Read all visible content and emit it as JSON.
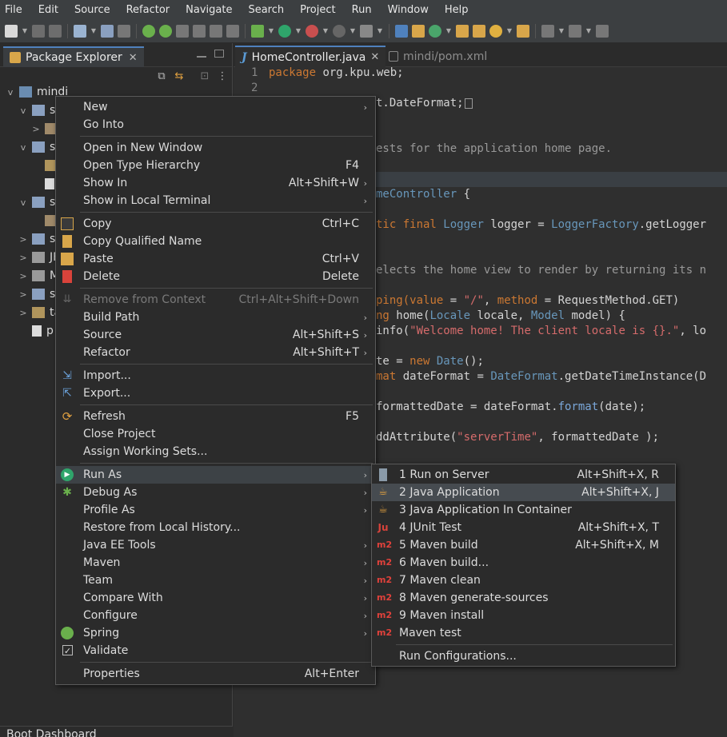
{
  "menubar": [
    "File",
    "Edit",
    "Source",
    "Refactor",
    "Navigate",
    "Search",
    "Project",
    "Run",
    "Window",
    "Help"
  ],
  "package_explorer": {
    "title": "Package Explorer",
    "tree": [
      {
        "label": "mindi",
        "arrow": "v"
      },
      {
        "label": "sr",
        "arrow": "v"
      },
      {
        "label": "",
        "arrow": ">"
      },
      {
        "label": "sr",
        "arrow": "v"
      },
      {
        "label": "",
        "arrow": ""
      },
      {
        "label": "",
        "arrow": ""
      },
      {
        "label": "sr",
        "arrow": "v"
      },
      {
        "label": "",
        "arrow": ""
      },
      {
        "label": "sr",
        "arrow": ">"
      },
      {
        "label": "JF",
        "arrow": ">"
      },
      {
        "label": "M",
        "arrow": ">"
      },
      {
        "label": "sr",
        "arrow": ">"
      },
      {
        "label": "ta",
        "arrow": ">"
      },
      {
        "label": "p",
        "arrow": ""
      }
    ]
  },
  "boot_dashboard": {
    "title": "Boot Dashboard"
  },
  "editor": {
    "tabs": [
      {
        "label": "HomeController.java",
        "active": true
      },
      {
        "label": "mindi/pom.xml",
        "active": false
      }
    ],
    "line_numbers": [
      "1",
      "2"
    ],
    "lines": {
      "l1_kw": "package",
      "l1_rest": " org.kpu.web;",
      "l3": "t.DateFormat;",
      "l6": "ests for the application home page.",
      "l9_a": "meController",
      "l9_b": " {",
      "l11_a": "tic final",
      "l11_b": "Logger",
      "l11_c": " logger = ",
      "l11_d": "LoggerFactory",
      "l11_e": ".getLogger",
      "l14": "elects the home view to render by returning its n",
      "l16_a": "ping(",
      "l16_b": "value",
      "l16_c": " = ",
      "l16_d": "\"/\"",
      "l16_e": ", ",
      "l16_f": "method",
      "l16_g": " = RequestMethod.GET)",
      "l17_a": "ng",
      "l17_b": " home(",
      "l17_c": "Locale",
      "l17_d": " locale, ",
      "l17_e": "Model",
      "l17_f": " model) {",
      "l18_a": "info(",
      "l18_b": "\"Welcome home! The client locale is {}.\"",
      "l18_c": ", lo",
      "l20_a": "te = ",
      "l20_b": "new",
      "l20_c": " Date",
      "l20_d": "();",
      "l21_a": "mat",
      "l21_b": " dateFormat = ",
      "l21_c": "DateFormat",
      "l21_d": ".getDateTimeInstance(D",
      "l23_a": "formattedDate = dateFormat.",
      "l23_b": "format",
      "l23_c": "(date);",
      "l25_a": "ddAttribute(",
      "l25_b": "\"serverTime\"",
      "l25_c": ", formattedDate );"
    }
  },
  "context_menu": {
    "items": [
      {
        "label": "New",
        "shortcut": "",
        "submenu": true
      },
      {
        "label": "Go Into",
        "shortcut": "",
        "submenu": false
      },
      {
        "label": "Open in New Window",
        "shortcut": "",
        "submenu": false
      },
      {
        "label": "Open Type Hierarchy",
        "shortcut": "F4",
        "submenu": false
      },
      {
        "label": "Show In",
        "shortcut": "Alt+Shift+W",
        "submenu": true
      },
      {
        "label": "Show in Local Terminal",
        "shortcut": "",
        "submenu": true
      },
      {
        "label": "Copy",
        "shortcut": "Ctrl+C",
        "submenu": false
      },
      {
        "label": "Copy Qualified Name",
        "shortcut": "",
        "submenu": false
      },
      {
        "label": "Paste",
        "shortcut": "Ctrl+V",
        "submenu": false
      },
      {
        "label": "Delete",
        "shortcut": "Delete",
        "submenu": false
      },
      {
        "label": "Remove from Context",
        "shortcut": "Ctrl+Alt+Shift+Down",
        "submenu": false,
        "disabled": true
      },
      {
        "label": "Build Path",
        "shortcut": "",
        "submenu": true
      },
      {
        "label": "Source",
        "shortcut": "Alt+Shift+S",
        "submenu": true
      },
      {
        "label": "Refactor",
        "shortcut": "Alt+Shift+T",
        "submenu": true
      },
      {
        "label": "Import...",
        "shortcut": "",
        "submenu": false
      },
      {
        "label": "Export...",
        "shortcut": "",
        "submenu": false
      },
      {
        "label": "Refresh",
        "shortcut": "F5",
        "submenu": false
      },
      {
        "label": "Close Project",
        "shortcut": "",
        "submenu": false
      },
      {
        "label": "Assign Working Sets...",
        "shortcut": "",
        "submenu": false
      },
      {
        "label": "Run As",
        "shortcut": "",
        "submenu": true,
        "selected": true
      },
      {
        "label": "Debug As",
        "shortcut": "",
        "submenu": true
      },
      {
        "label": "Profile As",
        "shortcut": "",
        "submenu": true
      },
      {
        "label": "Restore from Local History...",
        "shortcut": "",
        "submenu": false
      },
      {
        "label": "Java EE Tools",
        "shortcut": "",
        "submenu": true
      },
      {
        "label": "Maven",
        "shortcut": "",
        "submenu": true
      },
      {
        "label": "Team",
        "shortcut": "",
        "submenu": true
      },
      {
        "label": "Compare With",
        "shortcut": "",
        "submenu": true
      },
      {
        "label": "Configure",
        "shortcut": "",
        "submenu": true
      },
      {
        "label": "Spring",
        "shortcut": "",
        "submenu": true
      },
      {
        "label": "Validate",
        "shortcut": "",
        "submenu": false
      },
      {
        "label": "Properties",
        "shortcut": "Alt+Enter",
        "submenu": false
      }
    ]
  },
  "run_as_submenu": {
    "items": [
      {
        "label": "1 Run on Server",
        "shortcut": "Alt+Shift+X, R"
      },
      {
        "label": "2 Java Application",
        "shortcut": "Alt+Shift+X, J",
        "selected": true
      },
      {
        "label": "3 Java Application In Container",
        "shortcut": ""
      },
      {
        "label": "4 JUnit Test",
        "shortcut": "Alt+Shift+X, T"
      },
      {
        "label": "5 Maven build",
        "shortcut": "Alt+Shift+X, M"
      },
      {
        "label": "6 Maven build...",
        "shortcut": ""
      },
      {
        "label": "7 Maven clean",
        "shortcut": ""
      },
      {
        "label": "8 Maven generate-sources",
        "shortcut": ""
      },
      {
        "label": "9 Maven install",
        "shortcut": ""
      },
      {
        "label": "Maven test",
        "shortcut": ""
      },
      {
        "label": "Run Configurations...",
        "shortcut": ""
      }
    ],
    "m2_icon_text": "m2"
  },
  "colors": {
    "accent": "#4f81bd",
    "menu_bg": "#2b2b2b",
    "selection": "#3d4246",
    "keyword": "#cc7832",
    "type": "#6897bb",
    "string": "#d56b6b"
  }
}
